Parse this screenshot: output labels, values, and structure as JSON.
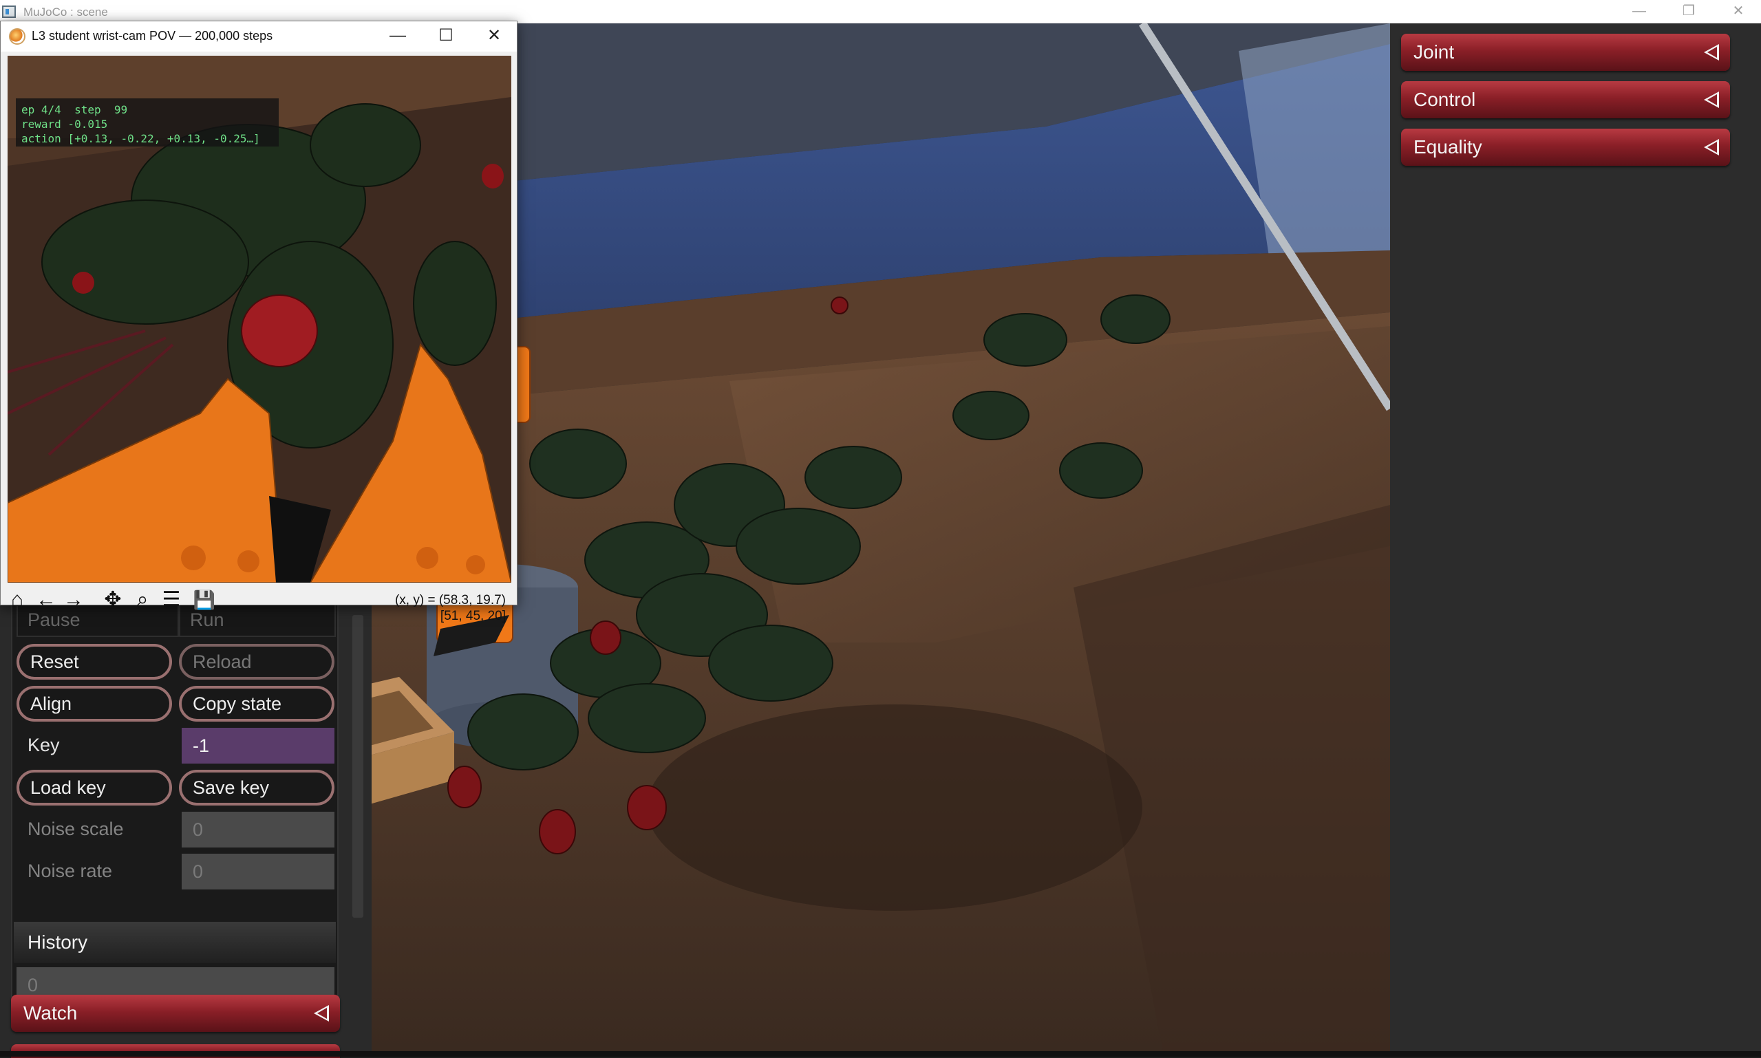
{
  "window": {
    "title": "MuJoCo : scene",
    "minimize": "—",
    "restore": "❐",
    "close": "✕"
  },
  "plot_window": {
    "title": "L3 student wrist-cam POV — 200,000 steps",
    "minimize": "—",
    "maximize": "☐",
    "close": "✕",
    "hud": {
      "line1": "ep 4/4  step  99",
      "line2": "reward -0.015",
      "line3": "action [+0.13, -0.22, +0.13, -0.25…]"
    },
    "toolbar": {
      "home": "⌂",
      "back": "←",
      "forward": "→",
      "pan": "✥",
      "zoom": "⌕",
      "configure": "☰",
      "save": "💾"
    },
    "coord_line1": "(x, y) = (58.3, 19.7)",
    "coord_line2": "[51, 45, 20]"
  },
  "simulation": {
    "pause": "Pause",
    "run": "Run",
    "reset": "Reset",
    "reload": "Reload",
    "align": "Align",
    "copy_state": "Copy state",
    "key_label": "Key",
    "key_value": "-1",
    "load_key": "Load key",
    "save_key": "Save key",
    "noise_scale_label": "Noise scale",
    "noise_scale_value": "0",
    "noise_rate_label": "Noise rate",
    "noise_rate_value": "0",
    "history_label": "History",
    "history_value": "0"
  },
  "left_sections": {
    "watch": "Watch"
  },
  "right_sections": [
    {
      "label": "Joint"
    },
    {
      "label": "Control"
    },
    {
      "label": "Equality"
    }
  ],
  "colors": {
    "section_red": "#8a1f27",
    "robot_orange": "#f07818",
    "active_field": "#5a3c6a",
    "hud_text": "#6fe088"
  }
}
